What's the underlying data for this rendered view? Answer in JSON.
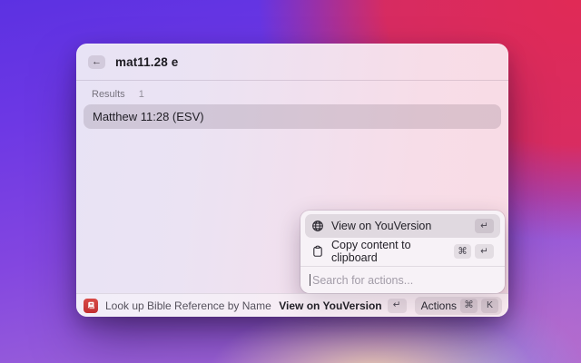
{
  "window": {
    "search_bar": {
      "back_icon": "←",
      "query": "mat11.28 e"
    },
    "results": {
      "label": "Results",
      "count": "1",
      "items": [
        {
          "title": "Matthew 11:28 (ESV)",
          "selected": true
        }
      ]
    },
    "actions_panel": {
      "items": [
        {
          "icon": "globe-icon",
          "label": "View on YouVersion",
          "keys": [
            "↵"
          ],
          "selected": true
        },
        {
          "icon": "clipboard-icon",
          "label": "Copy content to clipboard",
          "keys": [
            "⌘",
            "↵"
          ],
          "selected": false
        }
      ],
      "search_placeholder": "Search for actions..."
    },
    "footer": {
      "app_icon": "bible-app-icon",
      "command_title": "Look up Bible Reference by Name",
      "primary_action": {
        "label": "View on YouVersion",
        "keys": [
          "↵"
        ]
      },
      "actions_button": {
        "label": "Actions",
        "keys": [
          "⌘",
          "K"
        ]
      }
    }
  },
  "colors": {
    "desktop_purple": "#5c31e2",
    "desktop_red": "#e02a56",
    "desktop_peach": "#f7dbb4",
    "app_icon_red": "#c22f31",
    "selection_overlay": "rgba(72,52,72,0.15)"
  }
}
